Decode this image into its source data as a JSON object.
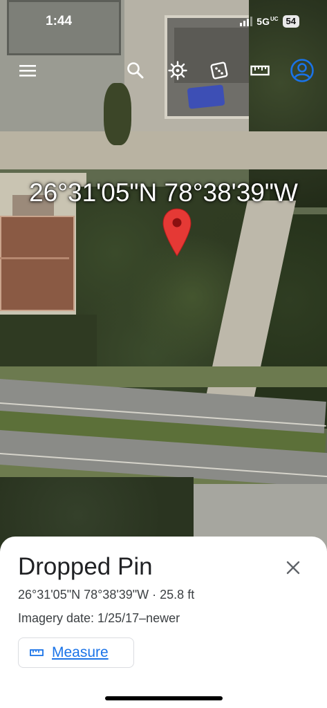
{
  "status_bar": {
    "time": "1:44",
    "network": "5G",
    "network_sub": "UC",
    "battery": "54"
  },
  "toolbar": {
    "icons": [
      "menu-icon",
      "search-icon",
      "voyager-wheel-icon",
      "feeling-lucky-dice-icon",
      "measure-ruler-icon",
      "account-icon"
    ]
  },
  "map": {
    "coordinate_label": "26°31'05\"N 78°38'39\"W",
    "pin_color": "#e53935"
  },
  "sheet": {
    "title": "Dropped Pin",
    "coords_line": "26°31'05\"N 78°38'39\"W · 25.8 ft",
    "imagery_date": "Imagery date: 1/25/17–newer",
    "measure_label": "Measure",
    "accent": "#1a73e8"
  }
}
